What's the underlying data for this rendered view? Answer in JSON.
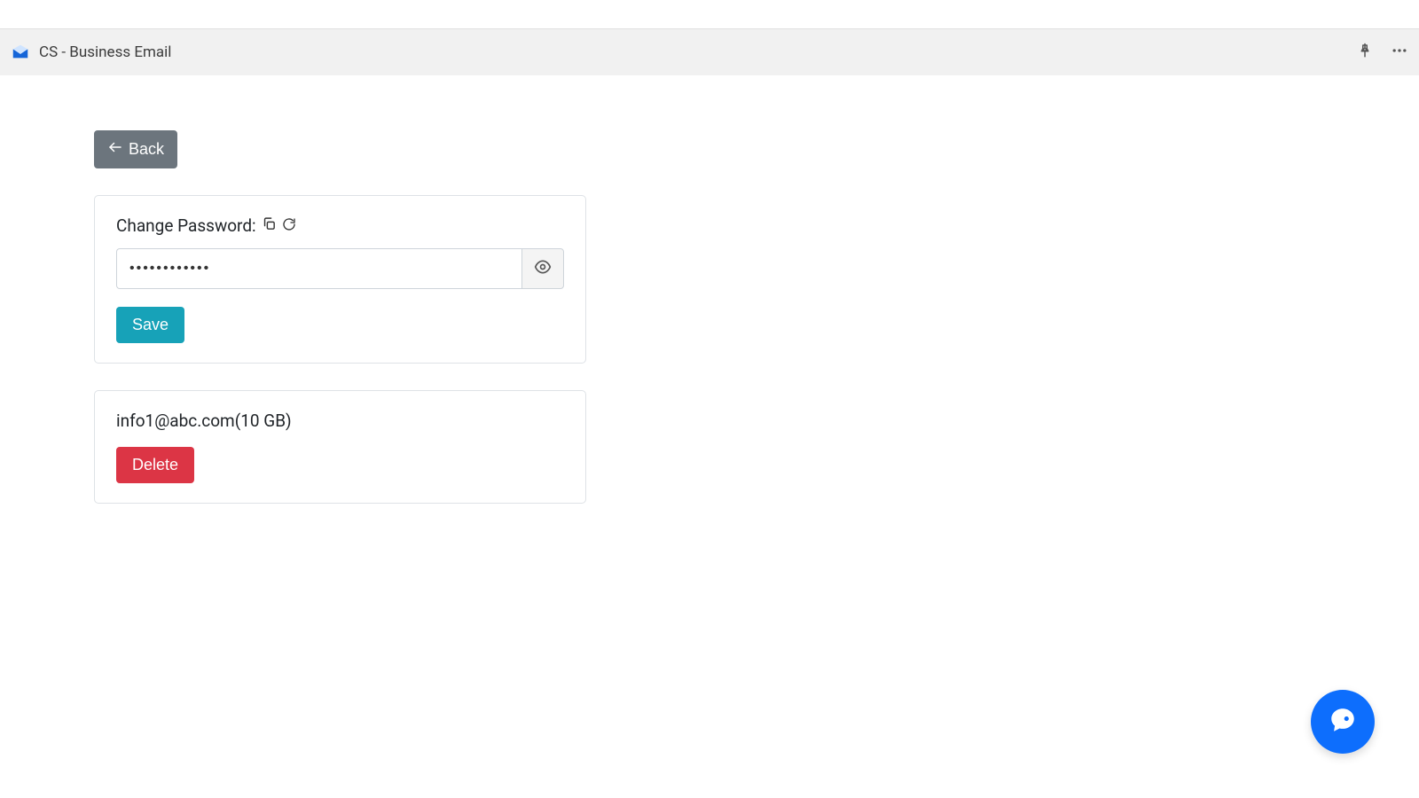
{
  "header": {
    "title": "CS - Business Email"
  },
  "back_button": {
    "label": "Back"
  },
  "password_card": {
    "label": "Change Password:",
    "value": "••••••••••••",
    "save_label": "Save"
  },
  "account_card": {
    "email": "info1@abc.com",
    "quota": "(10 GB)",
    "delete_label": "Delete"
  }
}
